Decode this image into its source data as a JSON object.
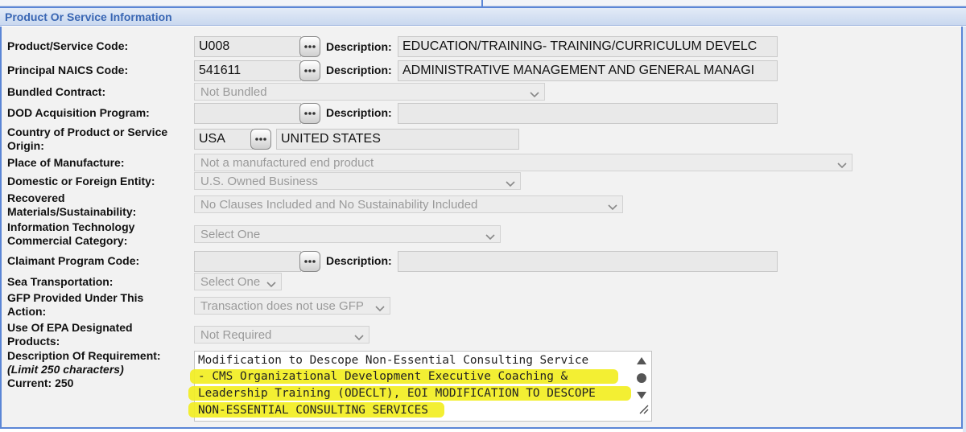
{
  "section": {
    "title": "Product Or Service Information"
  },
  "rows": {
    "psc": {
      "label": "Product/Service Code:",
      "value": "U008",
      "desc_label": "Description:",
      "desc_value": "EDUCATION/TRAINING- TRAINING/CURRICULUM DEVELC"
    },
    "naics": {
      "label": "Principal NAICS Code:",
      "value": "541611",
      "desc_label": "Description:",
      "desc_value": "ADMINISTRATIVE MANAGEMENT AND GENERAL MANAGI"
    },
    "bundled": {
      "label": "Bundled Contract:",
      "value": "Not Bundled"
    },
    "dod": {
      "label": "DOD Acquisition Program:",
      "value": "",
      "desc_label": "Description:",
      "desc_value": ""
    },
    "country": {
      "label_line1": "Country of Product or Service",
      "label_line2": "Origin:",
      "value": "USA",
      "desc_value": "UNITED STATES"
    },
    "manufacture": {
      "label": "Place of Manufacture:",
      "value": "Not a manufactured end product"
    },
    "entity": {
      "label": "Domestic or Foreign Entity:",
      "value": "U.S. Owned Business"
    },
    "recovered": {
      "label_line1": "Recovered",
      "label_line2": "Materials/Sustainability:",
      "value": "No Clauses Included and No Sustainability Included"
    },
    "it": {
      "label_line1": "Information Technology",
      "label_line2": "Commercial Category:",
      "value": "Select One"
    },
    "claimant": {
      "label": "Claimant Program Code:",
      "value": "",
      "desc_label": "Description:",
      "desc_value": ""
    },
    "sea": {
      "label": "Sea Transportation:",
      "value": "Select One"
    },
    "gfp": {
      "label_line1": "GFP Provided Under This",
      "label_line2": "Action:",
      "value": "Transaction does not use GFP"
    },
    "epa": {
      "label_line1": "Use Of EPA Designated",
      "label_line2": "Products:",
      "value": "Not Required"
    },
    "requirement": {
      "label": "Description Of Requirement:",
      "limit": "(Limit 250 characters)",
      "current": "Current: 250",
      "lines": [
        "Modification to Descope Non-Essential Consulting Service",
        "- CMS Organizational Development Executive Coaching &",
        "Leadership Training (ODECLT), EOI MODIFICATION TO DESCOPE",
        "NON-ESSENTIAL CONSULTING SERVICES"
      ]
    }
  },
  "icons": {
    "lookup": "ellipsis-lookup-icon",
    "dropdown": "chevron-down-icon"
  },
  "colors": {
    "accent": "#5b86d6",
    "header_text": "#3a67b4",
    "highlight": "#f2ee22",
    "panel": "#f2f2f2"
  }
}
